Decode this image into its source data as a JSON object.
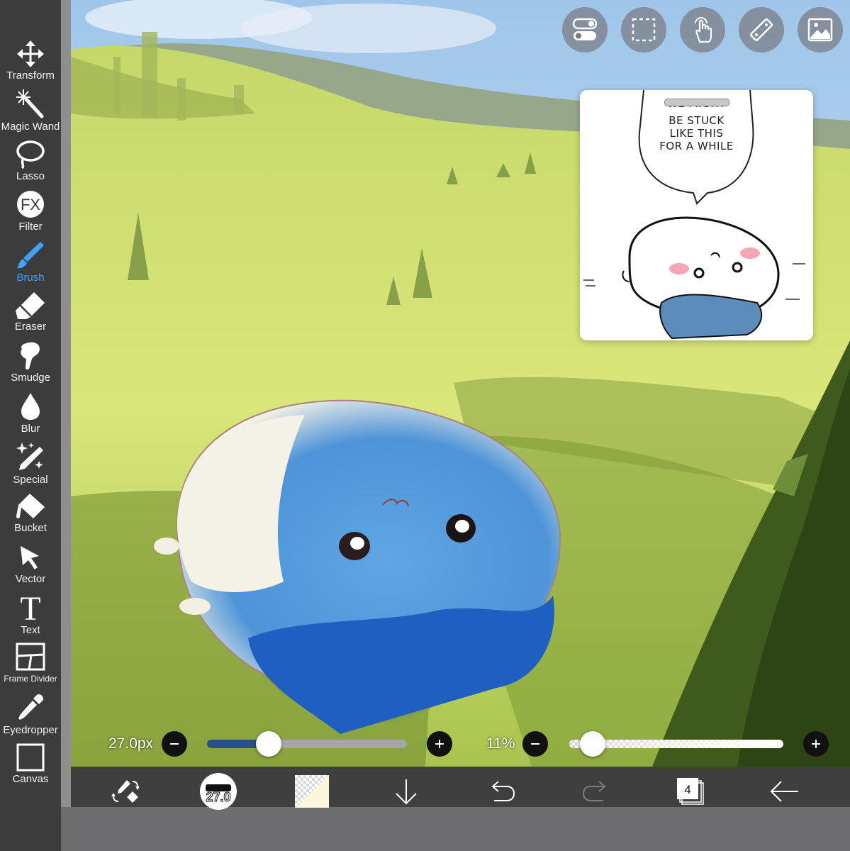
{
  "tools": [
    {
      "label": "Transform",
      "icon": "move-arrows-icon"
    },
    {
      "label": "Magic Wand",
      "icon": "magic-wand-icon"
    },
    {
      "label": "Lasso",
      "icon": "lasso-icon"
    },
    {
      "label": "Filter",
      "icon": "fx-icon",
      "icon_text": "FX"
    },
    {
      "label": "Brush",
      "icon": "brush-icon",
      "active": true
    },
    {
      "label": "Eraser",
      "icon": "eraser-icon"
    },
    {
      "label": "Smudge",
      "icon": "smudge-icon"
    },
    {
      "label": "Blur",
      "icon": "droplet-icon"
    },
    {
      "label": "Special",
      "icon": "sparkle-pen-icon"
    },
    {
      "label": "Bucket",
      "icon": "bucket-icon"
    },
    {
      "label": "Vector",
      "icon": "pointer-arrow-icon"
    },
    {
      "label": "Text",
      "icon": "text-t-icon",
      "icon_text": "T"
    },
    {
      "label": "Frame Divider",
      "icon": "frame-divider-icon"
    },
    {
      "label": "Eyedropper",
      "icon": "eyedropper-icon"
    },
    {
      "label": "Canvas",
      "icon": "canvas-square-icon"
    }
  ],
  "quick_buttons": [
    "toggle-switches-icon",
    "selection-rect-icon",
    "touch-hand-icon",
    "ruler-icon",
    "reference-image-icon"
  ],
  "reference": {
    "speech_lines": [
      "WE MIGHT",
      "BE STUCK",
      "LIKE THIS",
      "FOR A WHILE"
    ]
  },
  "brush_size": {
    "text": "27.0px",
    "level": 0.31
  },
  "opacity": {
    "text": "11%",
    "level": 0.11
  },
  "bottom_bar": {
    "brush_preview_text": "27.0",
    "layer_count": "4"
  },
  "colors": {
    "active": "#3ea3ff",
    "sidebar": "#3c3c3d",
    "bottombar": "#3f3f40",
    "slider_fill": "#2a4f8c"
  }
}
